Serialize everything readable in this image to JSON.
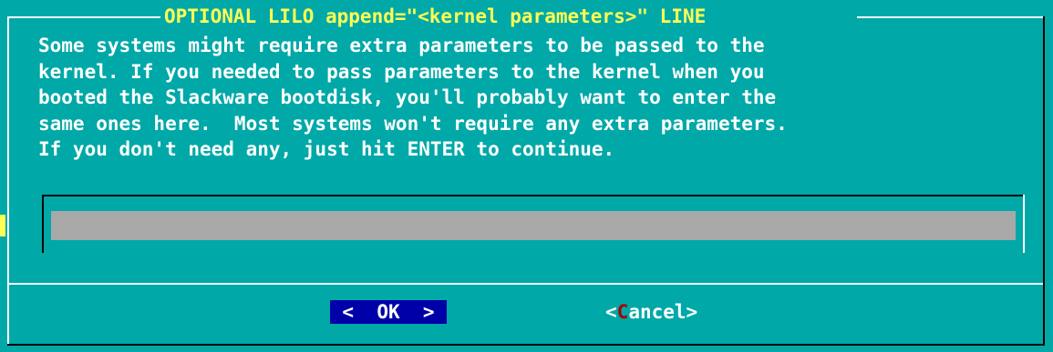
{
  "dialog": {
    "title": "OPTIONAL LILO append=\"<kernel parameters>\" LINE",
    "message_lines": [
      "Some systems might require extra parameters to be passed to the",
      "kernel. If you needed to pass parameters to the kernel when you",
      "booted the Slackware bootdisk, you'll probably want to enter the",
      "same ones here.  Most systems won't require any extra parameters.",
      "If you don't need any, just hit ENTER to continue."
    ],
    "input": {
      "value": "",
      "placeholder": ""
    },
    "buttons": {
      "ok_label": "<  OK  >",
      "cancel_open": "<",
      "cancel_hotkey": "C",
      "cancel_rest": "ancel",
      "cancel_close": ">"
    }
  },
  "colors": {
    "background": "#00a8a8",
    "title": "#ffff54",
    "text": "#ffffff",
    "input_bg": "#a8a8a8",
    "ok_bg": "#0000a8",
    "hotkey": "#a80000"
  }
}
